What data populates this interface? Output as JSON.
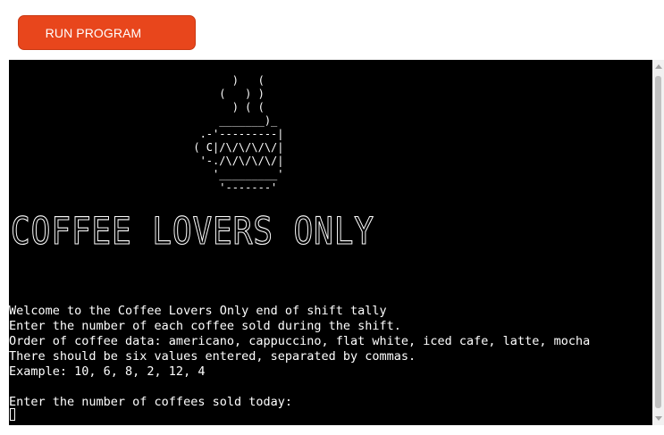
{
  "toolbar": {
    "run_label": "RUN PROGRAM"
  },
  "terminal": {
    "ascii_art": "            )   (\n          (   ) )\n            ) ( (\n          _______)_\n       .-'---------|\n      ( C|/\\/\\/\\/\\/|\n       '-./\\/\\/\\/\\/|\n         '_________'\n          '-------'",
    "logo_text": "Coffee Lovers Only",
    "lines": [
      "Welcome to the Coffee Lovers Only end of shift tally",
      "Enter the number of each coffee sold during the shift.",
      "Order of coffee data: americano, cappuccino, flat white, iced cafe, latte, mocha",
      "There should be six values entered, separated by commas.",
      "Example: 10, 6, 8, 2, 12, 4",
      "",
      "Enter the number of coffees sold today:"
    ]
  },
  "colors": {
    "run_button": "#e8461c",
    "terminal_bg": "#000000",
    "terminal_fg": "#ffffff"
  }
}
